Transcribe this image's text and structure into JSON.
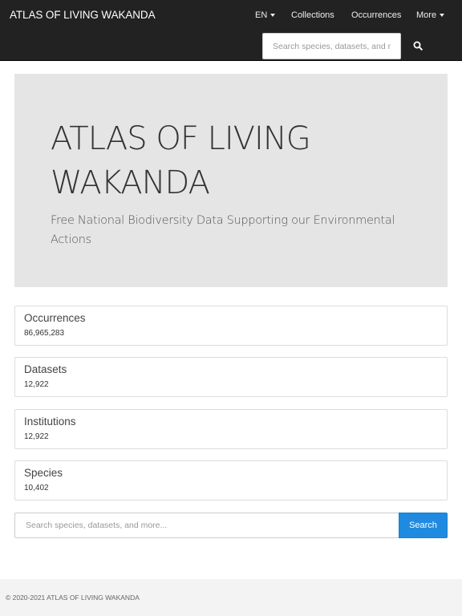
{
  "navbar": {
    "brand": "ATLAS OF LIVING WAKANDA",
    "items": [
      {
        "label": "EN",
        "has_dropdown": true
      },
      {
        "label": "Collections",
        "has_dropdown": false
      },
      {
        "label": "Occurrences",
        "has_dropdown": false
      },
      {
        "label": "More",
        "has_dropdown": true
      }
    ],
    "search": {
      "placeholder": "Search species, datasets, and more...",
      "value": "",
      "button_icon": "search-icon"
    }
  },
  "hero": {
    "title": "ATLAS OF LIVING WAKANDA",
    "subtitle": "Free National Biodiversity Data Supporting our Environmental Actions"
  },
  "stats": [
    {
      "label": "Occurrences",
      "value": "86,965,283"
    },
    {
      "label": "Datasets",
      "value": "12,922"
    },
    {
      "label": "Institutions",
      "value": "12,922"
    },
    {
      "label": "Species",
      "value": "10,402"
    }
  ],
  "search": {
    "placeholder": "Search species, datasets, and more...",
    "value": "",
    "button_label": "Search"
  },
  "footer": {
    "copyright": "© 2020-2021 ATLAS OF LIVING WAKANDA"
  },
  "colors": {
    "navbar_bg": "#222222",
    "hero_bg": "#e5e5e5",
    "accent": "#1f8ae0",
    "footer_bg": "#f3f3f3"
  }
}
